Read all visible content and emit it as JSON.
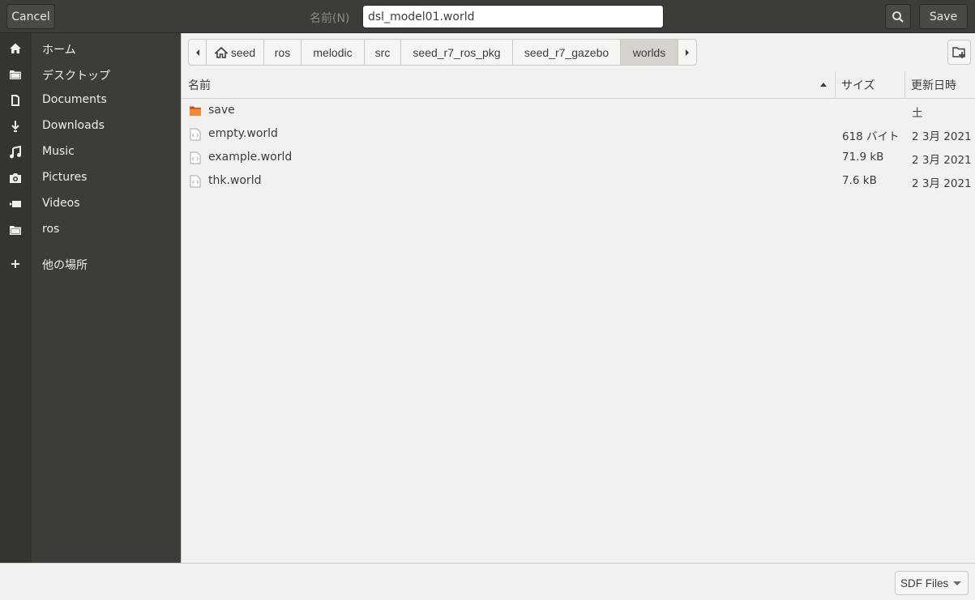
{
  "header": {
    "cancel_label": "Cancel",
    "name_label": "名前(N)",
    "filename_value": "dsl_model01.world",
    "save_label": "Save"
  },
  "sidebar": {
    "items": [
      {
        "label": "ホーム",
        "icon": "home-icon"
      },
      {
        "label": "デスクトップ",
        "icon": "folder-icon"
      },
      {
        "label": "Documents",
        "icon": "document-icon"
      },
      {
        "label": "Downloads",
        "icon": "download-icon"
      },
      {
        "label": "Music",
        "icon": "music-icon"
      },
      {
        "label": "Pictures",
        "icon": "camera-icon"
      },
      {
        "label": "Videos",
        "icon": "video-icon"
      },
      {
        "label": "ros",
        "icon": "folder-icon"
      },
      {
        "label": "他の場所",
        "icon": "plus-icon"
      }
    ]
  },
  "pathbar": {
    "crumbs": [
      "seed",
      "ros",
      "melodic",
      "src",
      "seed_r7_ros_pkg",
      "seed_r7_gazebo",
      "worlds"
    ],
    "active": "worlds"
  },
  "list": {
    "columns": {
      "name": "名前",
      "size": "サイズ",
      "modified": "更新日時"
    },
    "rows": [
      {
        "name": "save",
        "size": "",
        "modified": "土",
        "type": "folder"
      },
      {
        "name": "empty.world",
        "size": "618 バイト",
        "modified": "2 3月 2021",
        "type": "file"
      },
      {
        "name": "example.world",
        "size": "71.9 kB",
        "modified": "2 3月 2021",
        "type": "file"
      },
      {
        "name": "thk.world",
        "size": "7.6 kB",
        "modified": "2 3月 2021",
        "type": "file"
      }
    ]
  },
  "footer": {
    "filter_label": "SDF Files"
  }
}
